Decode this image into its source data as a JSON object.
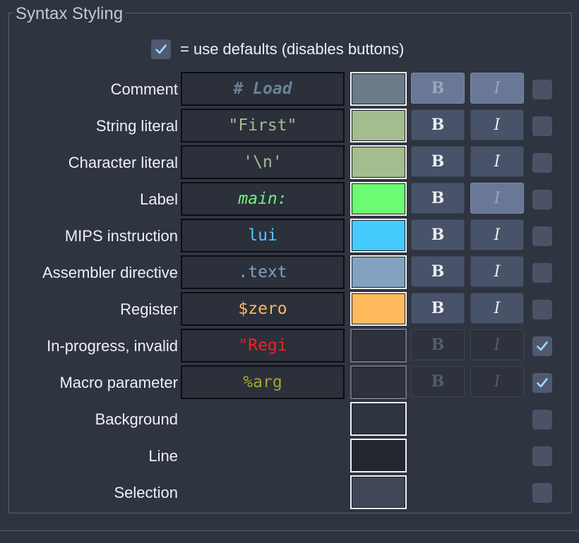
{
  "group_title": "Syntax Styling",
  "defaults_checkbox": {
    "label": "= use defaults (disables buttons)",
    "checked": true
  },
  "buttons": {
    "bold": "B",
    "italic": "I"
  },
  "rows": [
    {
      "label": "Comment",
      "sample": "# Load",
      "sample_color": "#6c8096",
      "sample_bold": true,
      "sample_italic": true,
      "swatch": "#6c7b89",
      "bold_pressed": true,
      "italic_pressed": true,
      "disabled": false,
      "checked": false
    },
    {
      "label": "String literal",
      "sample": "\"First\"",
      "sample_color": "#a4bd8f",
      "sample_bold": false,
      "sample_italic": false,
      "swatch": "#a3bd8e",
      "bold_pressed": false,
      "italic_pressed": false,
      "disabled": false,
      "checked": false
    },
    {
      "label": "Character literal",
      "sample": "'\\n'",
      "sample_color": "#a4bd8f",
      "sample_bold": false,
      "sample_italic": false,
      "swatch": "#a3bd8e",
      "bold_pressed": false,
      "italic_pressed": false,
      "disabled": false,
      "checked": false
    },
    {
      "label": "Label",
      "sample": "main:",
      "sample_color": "#6ef775",
      "sample_bold": false,
      "sample_italic": true,
      "swatch": "#6dfb74",
      "bold_pressed": false,
      "italic_pressed": true,
      "disabled": false,
      "checked": false
    },
    {
      "label": "MIPS instruction",
      "sample": "lui",
      "sample_color": "#4ec8ff",
      "sample_bold": false,
      "sample_italic": false,
      "swatch": "#45cbfd",
      "bold_pressed": false,
      "italic_pressed": false,
      "disabled": false,
      "checked": false
    },
    {
      "label": "Assembler directive",
      "sample": ".text",
      "sample_color": "#81a1c1",
      "sample_bold": false,
      "sample_italic": false,
      "swatch": "#82a2c1",
      "bold_pressed": false,
      "italic_pressed": false,
      "disabled": false,
      "checked": false
    },
    {
      "label": "Register",
      "sample": "$zero",
      "sample_color": "#ffb85c",
      "sample_bold": false,
      "sample_italic": false,
      "swatch": "#ffbb5d",
      "bold_pressed": false,
      "italic_pressed": false,
      "disabled": false,
      "checked": false
    },
    {
      "label": "In-progress, invalid",
      "sample": "\"Regi",
      "sample_color": "#ff1d1d",
      "sample_bold": false,
      "sample_italic": false,
      "swatch": "#2d323d",
      "bold_pressed": false,
      "italic_pressed": false,
      "disabled": true,
      "checked": true
    },
    {
      "label": "Macro parameter",
      "sample": "%arg",
      "sample_color": "#a9a52c",
      "sample_bold": false,
      "sample_italic": false,
      "swatch": "#2d323d",
      "bold_pressed": false,
      "italic_pressed": false,
      "disabled": true,
      "checked": true
    },
    {
      "label": "Background",
      "sample": null,
      "swatch": "#2f3441",
      "checked": false
    },
    {
      "label": "Line",
      "sample": null,
      "swatch": "#23262e",
      "checked": false
    },
    {
      "label": "Selection",
      "sample": null,
      "swatch": "#404657",
      "checked": false
    }
  ]
}
